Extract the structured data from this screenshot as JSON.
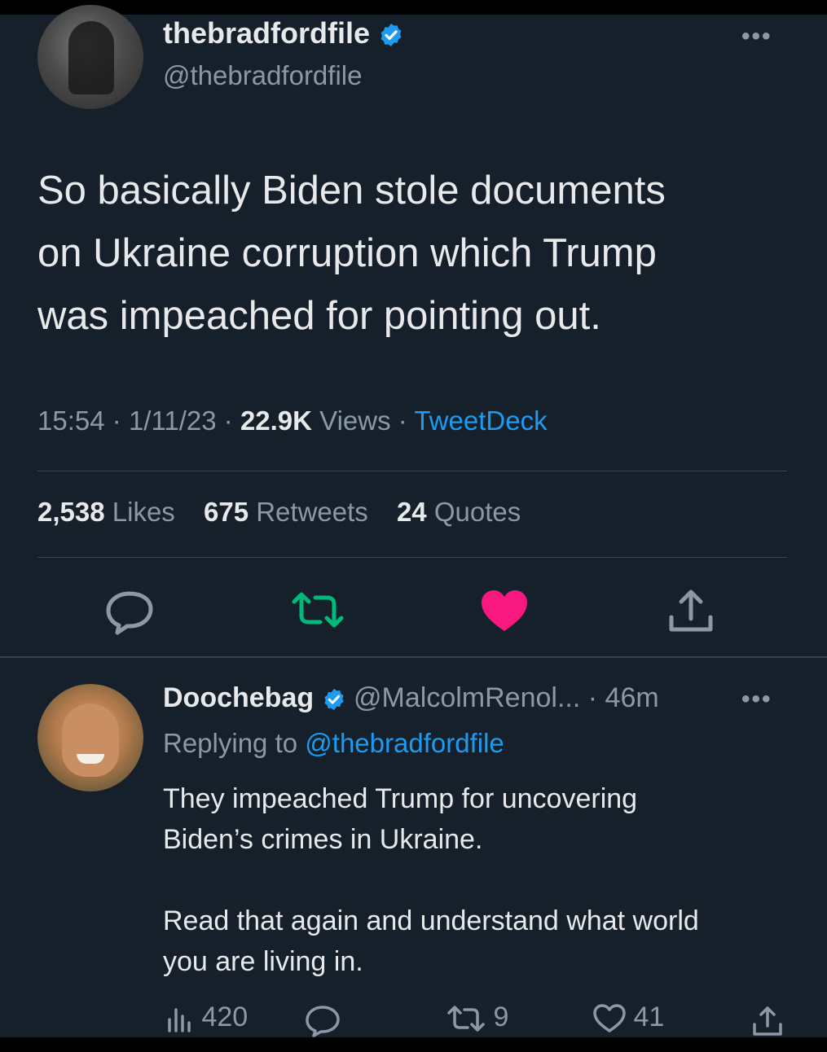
{
  "main_tweet": {
    "display_name": "thebradfordfile",
    "handle": "@thebradfordfile",
    "text_lines": [
      "So basically Biden stole documents",
      "on Ukraine corruption which Trump",
      "was impeached for pointing out."
    ],
    "time": "15:54",
    "date": "1/11/23",
    "views_count": "22.9K",
    "views_label": "Views",
    "source": "TweetDeck",
    "likes_count": "2,538",
    "likes_label": "Likes",
    "retweets_count": "675",
    "retweets_label": "Retweets",
    "quotes_count": "24",
    "quotes_label": "Quotes",
    "liked": true
  },
  "reply_tweet": {
    "display_name": "Doochebag",
    "handle": "@MalcolmRenol...",
    "age": "46m",
    "replying_label": "Replying to",
    "replying_to": "@thebradfordfile",
    "paragraph1_lines": [
      "They impeached Trump for uncovering",
      "Biden’s crimes in Ukraine."
    ],
    "paragraph2_lines": [
      "Read that again and understand what world",
      "you are living in."
    ],
    "views": "420",
    "retweets": "9",
    "likes": "41"
  },
  "icons": {
    "verified": "verified-badge-icon",
    "more": "more-icon",
    "reply": "reply-icon",
    "retweet": "retweet-icon",
    "like": "heart-icon",
    "share": "share-icon",
    "views": "views-icon"
  },
  "colors": {
    "background": "#15202b",
    "accent": "#1d9bf0",
    "retweet": "#00ba7c",
    "like": "#f91880",
    "muted": "#8b98a5"
  }
}
